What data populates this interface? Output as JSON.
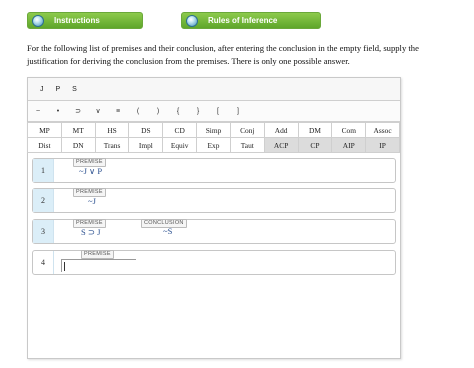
{
  "tabs": [
    {
      "label": "Instructions"
    },
    {
      "label": "Rules of Inference"
    }
  ],
  "instructions_text": "For the following list of premises and their conclusion, after entering the conclusion in the empty field, supply the justification for deriving the conclusion from the premises. There is only one possible answer.",
  "variables": [
    "J",
    "P",
    "S"
  ],
  "symbols": [
    "~",
    "•",
    "⊃",
    "∨",
    "≡",
    "(",
    ")",
    "{",
    "}",
    "[",
    "]"
  ],
  "rules_row1": [
    "MP",
    "MT",
    "HS",
    "DS",
    "CD",
    "Simp",
    "Conj",
    "Add",
    "DM",
    "Com",
    "Assoc"
  ],
  "rules_row2": [
    "Dist",
    "DN",
    "Trans",
    "Impl",
    "Equiv",
    "Exp",
    "Taut",
    "ACP",
    "CP",
    "AIP",
    "IP"
  ],
  "lines": [
    {
      "number": "1",
      "tag": "PREMISE",
      "formula": "~J ∨ P"
    },
    {
      "number": "2",
      "tag": "PREMISE",
      "formula": "~J"
    },
    {
      "number": "3",
      "tag": "PREMISE",
      "formula": "S ⊃ J",
      "conclusion_tag": "CONCLUSION",
      "conclusion": "~S"
    },
    {
      "number": "4",
      "tag": "PREMISE",
      "formula": ""
    }
  ],
  "colors": {
    "tab_green": "#6cb33a",
    "highlight_blue": "#dbeef8",
    "formula_blue": "#2a4f8f",
    "gray_button": "#dcdcdc"
  }
}
